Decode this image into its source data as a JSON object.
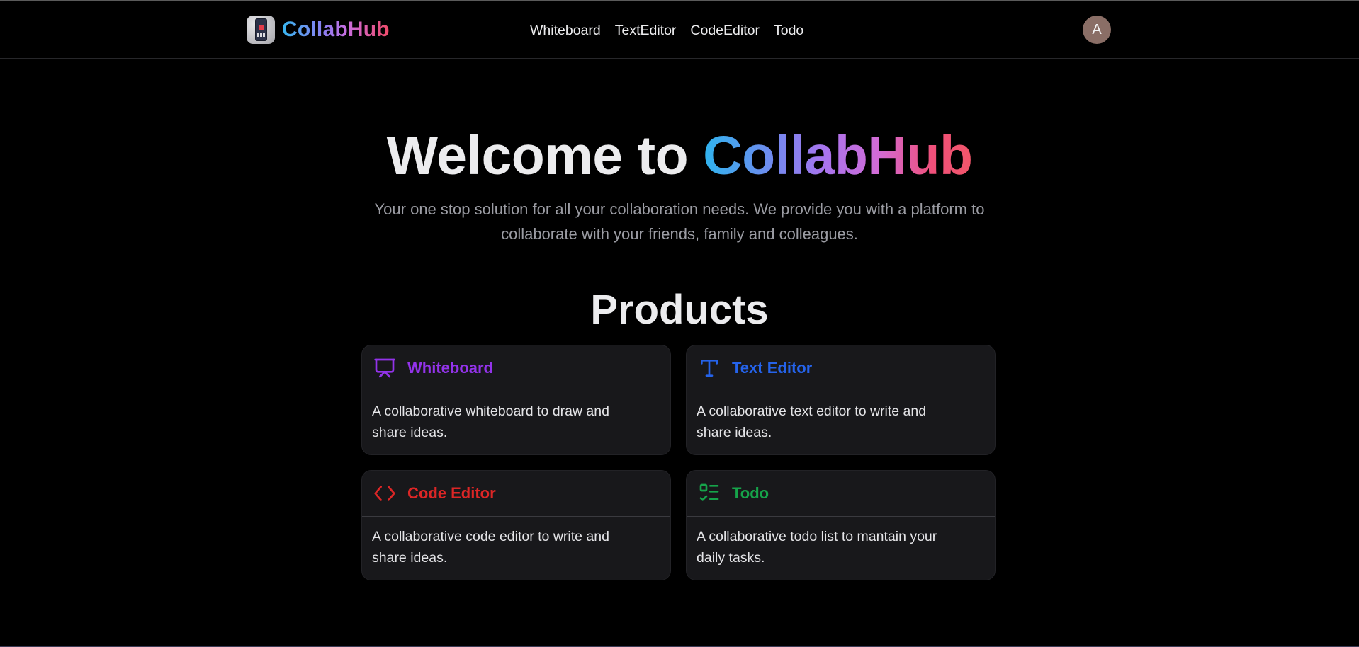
{
  "header": {
    "brand": "CollabHub",
    "logo_icon": "app-logo",
    "nav": [
      "Whiteboard",
      "TextEditor",
      "CodeEditor",
      "Todo"
    ],
    "avatar_initial": "A"
  },
  "hero": {
    "title_prefix": "Welcome to ",
    "title_highlight": "CollabHub",
    "subtitle_line1": "Your one stop solution for all your collaboration needs. We provide you with a platform to",
    "subtitle_line2": "collaborate with your friends, family and colleagues."
  },
  "products": {
    "heading": "Products",
    "items": [
      {
        "title": "Whiteboard",
        "icon": "presentation-board-icon",
        "color": "#9333ea",
        "description": "A collaborative whiteboard to draw and share ideas."
      },
      {
        "title": "Text Editor",
        "icon": "text-type-icon",
        "color": "#2563eb",
        "description": "A collaborative text editor to write and share ideas."
      },
      {
        "title": "Code Editor",
        "icon": "code-brackets-icon",
        "color": "#dc2626",
        "description": "A collaborative code editor to write and share ideas."
      },
      {
        "title": "Todo",
        "icon": "checklist-icon",
        "color": "#16a34a",
        "description": "A collaborative todo list to mantain your daily tasks."
      }
    ]
  },
  "colors": {
    "background": "#000000",
    "card_background": "#18181b",
    "avatar_background": "#8a6e66",
    "subtitle": "#9b9ca3"
  }
}
